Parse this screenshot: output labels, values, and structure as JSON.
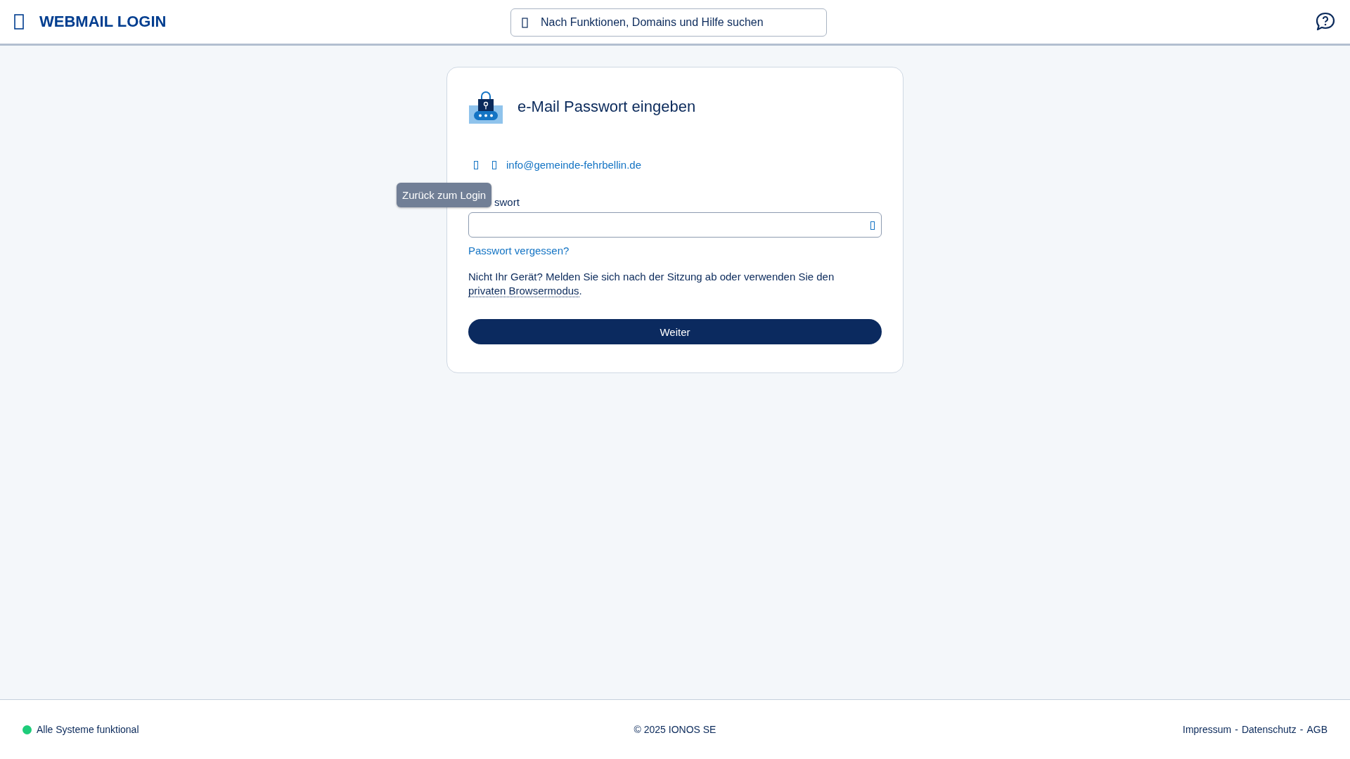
{
  "header": {
    "title": "WEBMAIL LOGIN",
    "search": {
      "placeholder": "Nach Funktionen, Domains und Hilfe suchen"
    }
  },
  "card": {
    "title": "e-Mail Passwort eingeben",
    "email": "info@gemeinde-fehrbellin.de",
    "tooltip": "Zurück zum Login",
    "password_label": "swort",
    "forgot_link": "Passwort vergessen?",
    "notice": "Nicht Ihr Gerät? Melden Sie sich nach der Sitzung ab oder verwenden Sie den ",
    "notice_link": "privaten Browsermodus",
    "notice_end": ".",
    "button": "Weiter"
  },
  "footer": {
    "status": {
      "text": "Alle Systeme funktional",
      "color": "#1ecc7a"
    },
    "copyright": "© 2025 IONOS SE",
    "links": [
      {
        "label": "Impressum"
      },
      {
        "label": "Datenschutz"
      },
      {
        "label": "AGB"
      }
    ],
    "separator": "-"
  }
}
